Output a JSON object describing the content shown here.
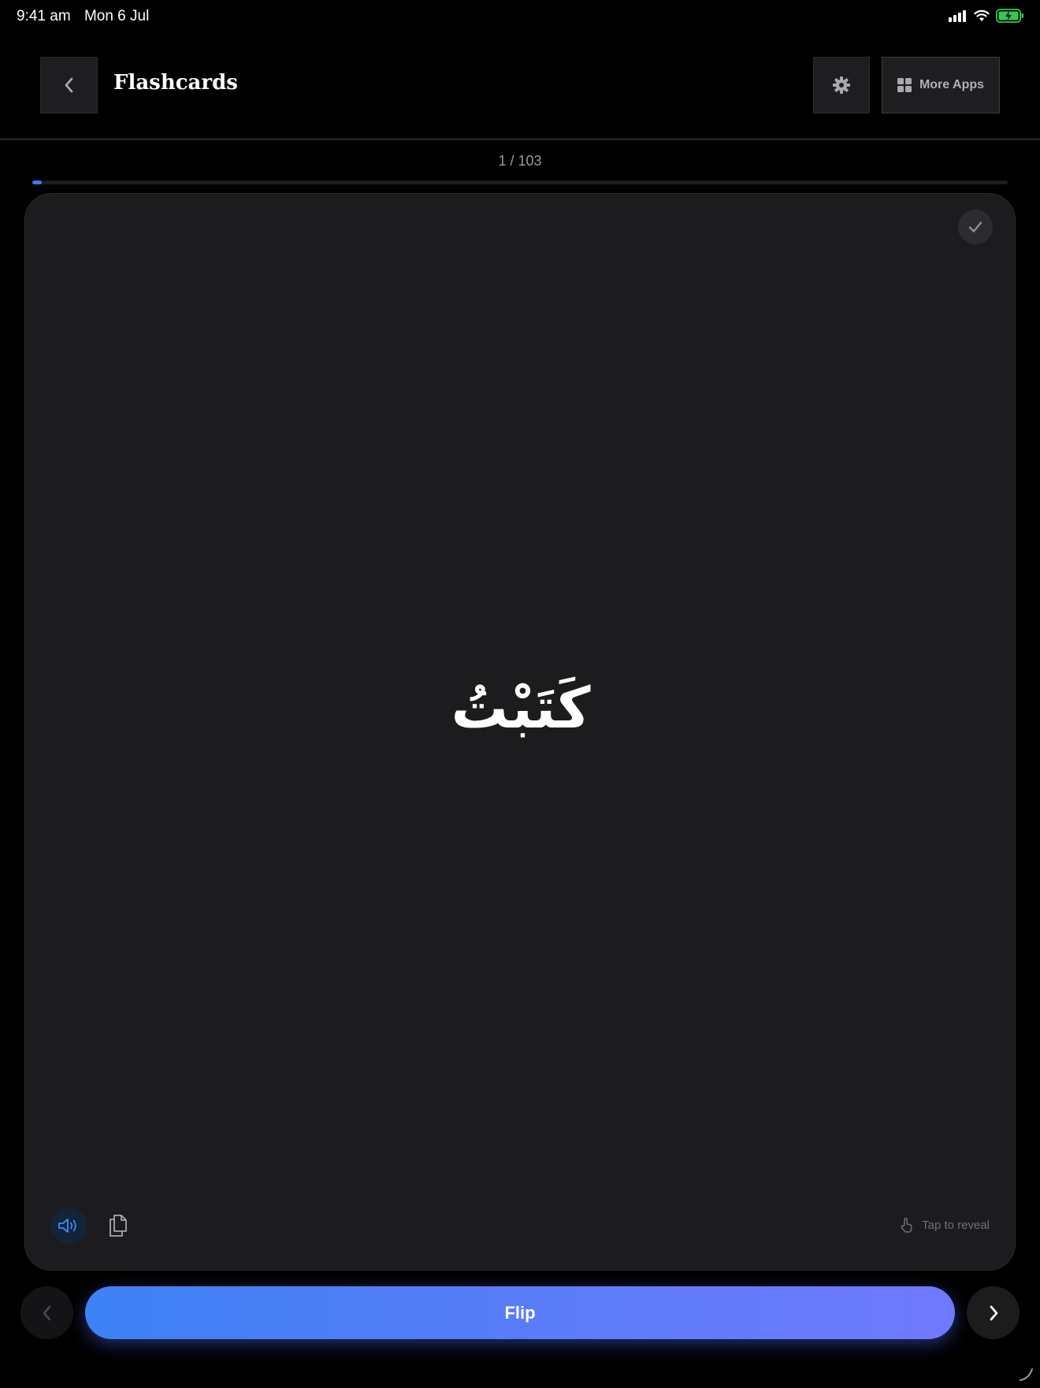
{
  "status_bar": {
    "time": "9:41 am",
    "date": "Mon 6 Jul",
    "battery_color": "#34c759"
  },
  "header": {
    "title": "Flashcards",
    "more_apps_label": "More Apps"
  },
  "progress": {
    "counter": "1 / 103",
    "current": 1,
    "total": 103,
    "accent": "#3a7bf0"
  },
  "card": {
    "word": "كَتَبْتُ",
    "tap_hint": "Tap to reveal"
  },
  "controls": {
    "flip_label": "Flip"
  },
  "icons": {
    "back": "chevron-left-icon",
    "settings": "gear-icon",
    "more_apps": "grid-icon",
    "check": "checkmark-icon",
    "speaker": "speaker-icon",
    "copy": "copy-icon",
    "tap": "hand-tap-icon",
    "prev": "chevron-left-icon",
    "next": "chevron-right-icon"
  }
}
